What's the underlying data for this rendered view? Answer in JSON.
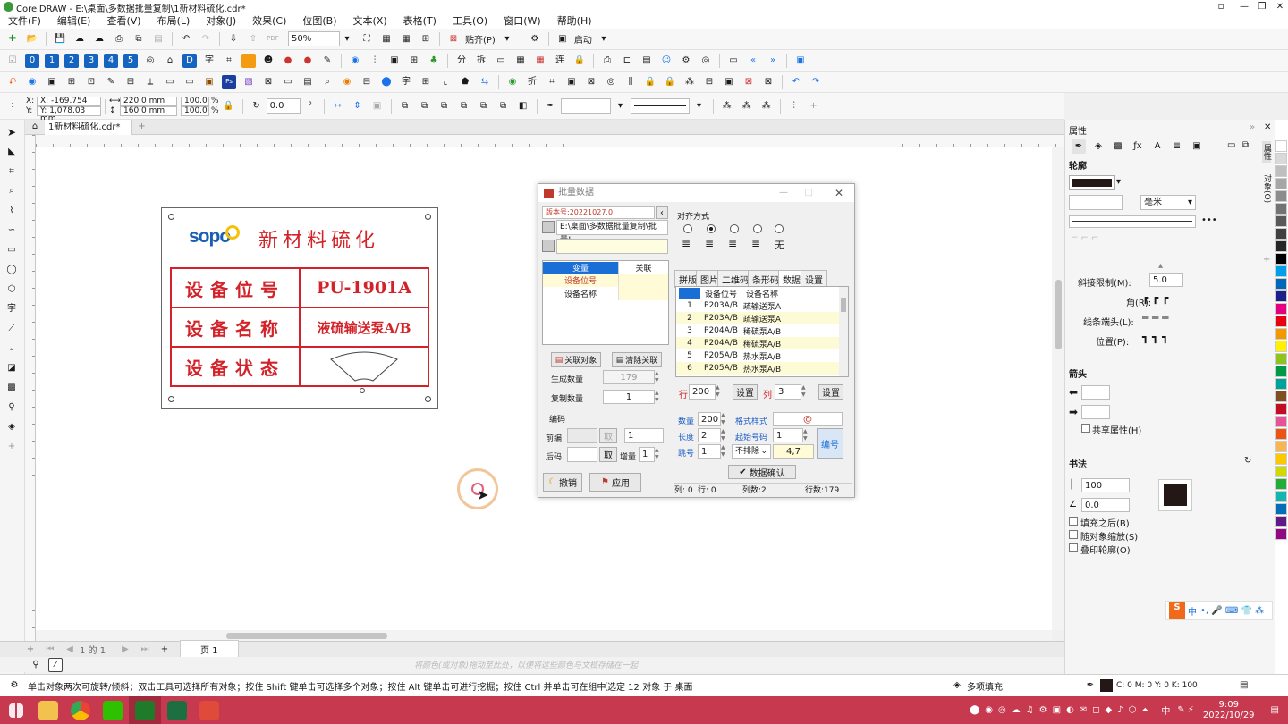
{
  "window": {
    "title": "CorelDRAW - E:\\桌面\\多数据批量复制\\1新材料硫化.cdr*"
  },
  "menu": [
    "文件(F)",
    "编辑(E)",
    "查看(V)",
    "布局(L)",
    "对象(J)",
    "效果(C)",
    "位图(B)",
    "文本(X)",
    "表格(T)",
    "工具(O)",
    "窗口(W)",
    "帮助(H)"
  ],
  "toolbar": {
    "zoom": "50%",
    "paste_label": "贴齐(P)",
    "launch_label": "启动"
  },
  "propbar": {
    "x": "X: -169.754 mm",
    "y": "Y: 1,078.03 mm",
    "w": "220.0 mm",
    "h": "160.0 mm",
    "sx": "100.0",
    "sy": "100.0",
    "pct": "%",
    "angle": "0.0"
  },
  "doctab": {
    "name": "1新材料硫化.cdr*"
  },
  "label": {
    "brand": "sopo",
    "brand_cn": "新材料硫化",
    "rows": [
      {
        "key": "设备位号",
        "value": "PU-1901A"
      },
      {
        "key": "设备名称",
        "value": "液硫输送泵A/B"
      },
      {
        "key": "设备状态",
        "value": ""
      }
    ]
  },
  "dialog": {
    "title": "批量数据",
    "version": "版本号:20221027.0",
    "path": "E:\\桌面\\多数据批量复制\\批量!",
    "align_label": "对齐方式",
    "align_none": "无",
    "var_header": "变量",
    "link_header": "关联",
    "vars": [
      "设备位号",
      "设备名称"
    ],
    "btn_link": "关联对象",
    "btn_clear": "清除关联",
    "gen_count_label": "生成数量",
    "gen_count": "179",
    "copy_count_label": "复制数量",
    "copy_count": "1",
    "code_label": "编码",
    "prefix_label": "前编",
    "take_label": "取",
    "prefix_num": "1",
    "suffix_label": "后码",
    "take2_label": "取",
    "inc_label": "增量",
    "inc": "1",
    "undo": "撤销",
    "apply": "应用",
    "tabs": [
      "拼版",
      "图片",
      "二维码",
      "条形码",
      "数据",
      "设置"
    ],
    "table_headers": [
      "设备位号",
      "设备名称"
    ],
    "table_rows": [
      {
        "n": "1",
        "a": "P203A/B",
        "b": "疏输送泵A"
      },
      {
        "n": "2",
        "a": "P203A/B",
        "b": "疏输送泵A"
      },
      {
        "n": "3",
        "a": "P204A/B",
        "b": "稀硫泵A/B"
      },
      {
        "n": "4",
        "a": "P204A/B",
        "b": "稀硫泵A/B"
      },
      {
        "n": "5",
        "a": "P205A/B",
        "b": "热水泵A/B"
      },
      {
        "n": "6",
        "a": "P205A/B",
        "b": "热水泵A/B"
      }
    ],
    "row_label": "行",
    "row_val": "200",
    "set1": "设置",
    "col_label": "列",
    "col_val": "3",
    "set2": "设置",
    "qty_label": "数量",
    "qty": "200",
    "fmt_label": "格式样式",
    "fmt": "@",
    "len_label": "长度",
    "len": "2",
    "start_label": "起始号码",
    "start": "1",
    "skip_label": "跳号",
    "skip": "1",
    "exclude": "不排除",
    "exclude_val": "4,7",
    "num_btn": "编号",
    "confirm_btn": "数据确认",
    "status": [
      "列: 0",
      "行: 0",
      "列数:2",
      "行数:179"
    ]
  },
  "props": {
    "title": "属性",
    "outline": "轮廓",
    "unit": "毫米",
    "miter_label": "斜接限制(M):",
    "miter": "5.0",
    "corner_label": "角(R):",
    "cap_label": "线条端头(L):",
    "pos_label": "位置(P):",
    "arrow_label": "箭头",
    "share_label": "共享属性(H)",
    "calligraphy_label": "书法",
    "stretch": "100",
    "angle": "0.0",
    "fill_after": "填充之后(B)",
    "scale_with": "随对象缩放(S)",
    "overprint": "叠印轮廓(O)",
    "side_tabs": [
      "属性",
      "对象(O)"
    ]
  },
  "pages": {
    "nav": "1 的 1",
    "page_tab": "页 1"
  },
  "hint": "将颜色(或对象)拖动至此处，以便将这些颜色与文档存储在一起",
  "status": {
    "msg": "单击对象两次可旋转/倾斜；双击工具可选择所有对象；按住 Shift 键单击可选择多个对象；按住 Alt 键单击可进行挖掘；按住 Ctrl 并单击可在组中选择",
    "selection": "选定 12 对象 于 桌面",
    "fill": "多项填充",
    "cmyk": "C: 0 M: 0 Y: 0 K: 100"
  },
  "tray": {
    "time": "9:09",
    "date": "2022/10/29",
    "ime": "中"
  },
  "colors": {
    "accent_red": "#d3232a",
    "taskbar": "#c7394f",
    "selected_blue": "#1a6fd6"
  }
}
